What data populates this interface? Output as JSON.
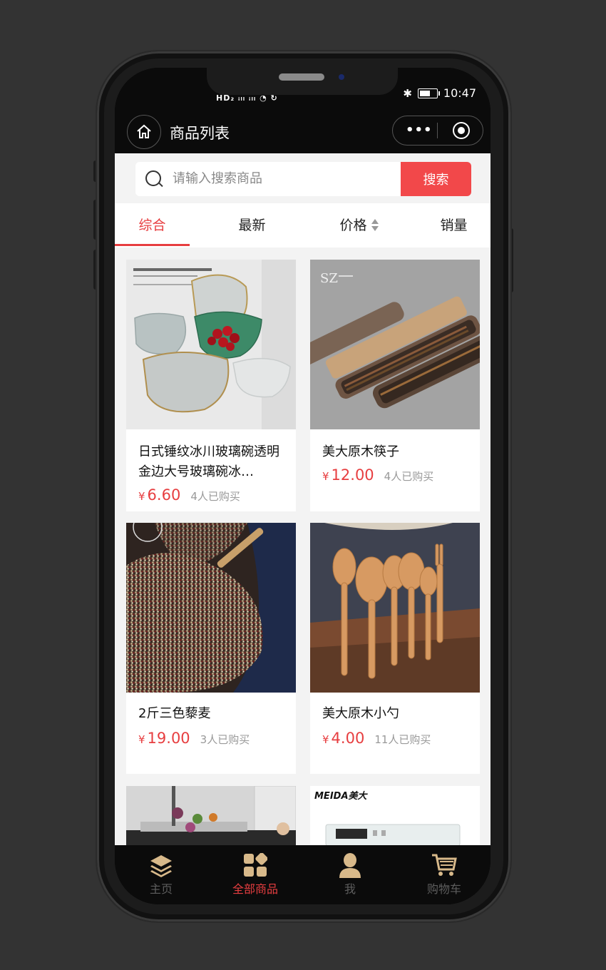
{
  "status": {
    "left_text": "HD₂ ᵢₗₗ ᵢₗₗ ◔ ↻",
    "time": "10:47"
  },
  "navbar": {
    "title": "商品列表"
  },
  "search": {
    "placeholder": "请输入搜索商品",
    "button": "搜索"
  },
  "tabs": [
    {
      "label": "综合",
      "active": true
    },
    {
      "label": "最新",
      "active": false
    },
    {
      "label": "价格",
      "active": false
    },
    {
      "label": "销量",
      "active": false
    }
  ],
  "products": [
    {
      "name": "日式锤纹冰川玻璃碗透明金边大号玻璃碗冰…",
      "currency": "¥",
      "price": "6.60",
      "sold": "4人已购买",
      "image": "glass-bowls"
    },
    {
      "name": "美大原木筷子",
      "currency": "¥",
      "price": "12.00",
      "sold": "4人已购买",
      "image": "wooden-chopsticks"
    },
    {
      "name": "2斤三色藜麦",
      "currency": "¥",
      "price": "19.00",
      "sold": "3人已购买",
      "image": "quinoa"
    },
    {
      "name": "美大原木小勺",
      "currency": "¥",
      "price": "4.00",
      "sold": "11人已购买",
      "image": "wooden-spoons"
    },
    {
      "name": "",
      "image": "kitchen-sink"
    },
    {
      "name": "",
      "image": "meida-appliance",
      "brand_text": "MEIDA美大"
    }
  ],
  "tabbar": [
    {
      "label": "主页",
      "icon": "layers-icon",
      "active": false
    },
    {
      "label": "全部商品",
      "icon": "grid-icon",
      "active": true
    },
    {
      "label": "我",
      "icon": "person-icon",
      "active": false
    },
    {
      "label": "购物车",
      "icon": "cart-icon",
      "active": false
    }
  ],
  "colors": {
    "accent": "#e73e40",
    "search_button": "#f2484a",
    "icon_gold": "#d8b98a"
  }
}
